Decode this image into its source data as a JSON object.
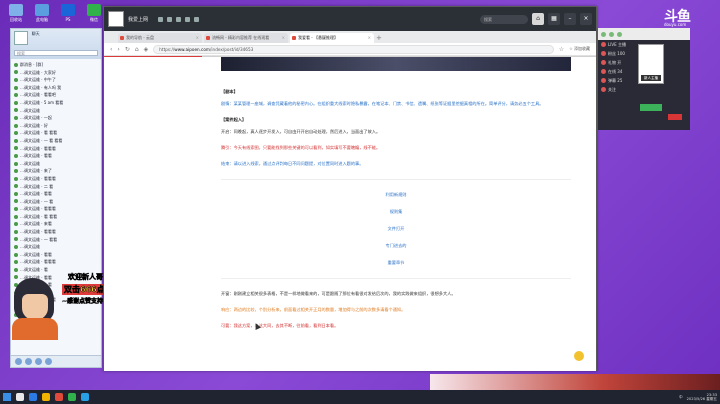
{
  "desktop": {
    "icons": [
      {
        "label": "回收站",
        "color": "#7fb0e8"
      },
      {
        "label": "此电脑",
        "color": "#5a9ee0"
      },
      {
        "label": "PS",
        "color": "#1a66d9"
      },
      {
        "label": "微信",
        "color": "#2fb34a"
      },
      {
        "label": "QQ",
        "color": "#27a0e6"
      }
    ]
  },
  "chat": {
    "title": "聊天",
    "search_placeholder": "搜索",
    "rows": [
      "群消息 ·  [群]",
      "…调文运维 · 大家好",
      "…调文运维 · 中午了",
      "…调文运维 · 有人吗 我",
      "…调文运维 · 看看吧",
      "…调文运维 · 5 am 看看",
      "…调文运维",
      "…调文运维 · 一起",
      "…调文运维 · 好",
      "…调文运维 · 看 看看",
      "…调文运维 · 一 看 看看",
      "…调文运维 · 看看看",
      "…调文运维 · 看看",
      "…调文运维",
      "…调文运维 · 来了",
      "…调文运维 · 看看看",
      "…调文运维 · 二 看",
      "…调文运维 · 看看",
      "…调文运维 · 一 看",
      "…调文运维 · 看看看",
      "…调文运维 · 看 看看",
      "…调文运维 · 来看",
      "…调文运维 · 看看看",
      "…调文运维 · 一 看看",
      "…调文运维",
      "…调文运维 · 看看",
      "…调文运维 · 看看看",
      "…调文运维 · 看",
      "…调文运维 · 看看",
      "…调文运维 · 一看",
      "…调文运维 · 看看",
      "…调文运维 · 看看看",
      "…调文运维 · 一 看",
      "…调文运维 · 看看",
      "…调文运维 · 看"
    ]
  },
  "sticker": {
    "line1": "欢迎新人哥哥",
    "line2": "双击666点关注",
    "line3": "~感谢点赞支持~"
  },
  "browser": {
    "app_name": "我爱上网",
    "app_search": "搜索",
    "tabs": [
      {
        "label": "我的导航 - 云盘"
      },
      {
        "label": "流畅网 - 精彩内容推荐 在线观看"
      },
      {
        "label": "我爱看 - 【悬疑推理】"
      }
    ],
    "address_prefix": "https://",
    "address_host": "www.aipoen.com",
    "address_path": "/index/post/id/34653",
    "favorite_label": "☆ 添加收藏",
    "page_progress": 0.2
  },
  "article": {
    "sec1_title": "【剧本】",
    "sec1_text": "剧情：某某管理一座城，调查凭藏着他的秘密内心。在组织重大线索时隐私暴露，在笔记本、门禁、书信、遗嘱、纸张等证据里挖掘真相的所在。简单评分，请务必五个工具。",
    "sec2_title": "【案件起入】",
    "sec2_p1": "开启：同晚起，真人逐步开发入，可自由开开启自动处理，然后进入，当面出了故入。",
    "sec2_p2": "腾引：今天有线索图，只要能找到那些关键的可以看到，如实填写不要瞎编，线不能。",
    "sec2_p3": "结束：请以进入线索，通过点评判每日不同问题提，对位置同时进入题的事。",
    "links": [
      "利用新规则",
      "规则集",
      "文件打开",
      "专门进去的",
      "重要章节"
    ],
    "sec3_p1": "开窗：刚刚建立相关很多表格，不是一样地做看来的，可是跟随了那位有看很对发给后次的，我的实践做来组织，很想多大人。",
    "sec3_p2": "响应：两边的比较，个别分析来，前面看过相关开正月的数量，增加得与之前的次数多请看个通知。",
    "sec3_p3": "可要：我这方案，与这大同，去其不断，往前看，看到日本看。"
  },
  "right_panel": {
    "tag": "新人主播",
    "rows": [
      "LIVE  主播",
      "粉丝  100",
      "礼物  开",
      "在线  34",
      "弹幕  25",
      "关注"
    ]
  },
  "streamer_logo": "斗鱼",
  "streamer_sub": "douyu.com",
  "taskbar": {
    "time": "23:33",
    "date": "2023/5/26 星期五",
    "lang": "中"
  },
  "colors": {
    "wallpaper": "#7a3fc0",
    "accent_red": "#d93a3a",
    "link_blue": "#2a71c7"
  }
}
